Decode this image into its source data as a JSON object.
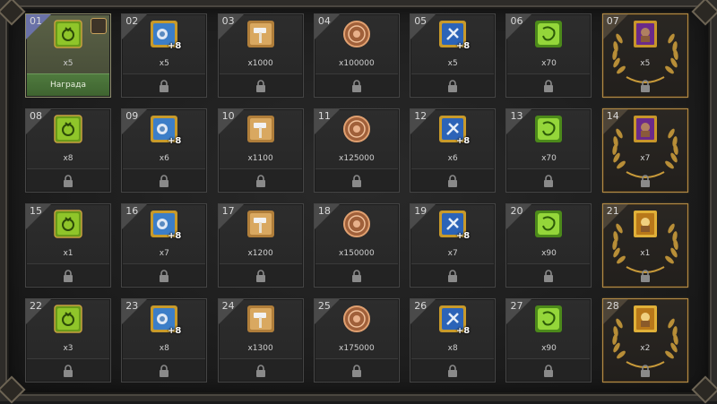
{
  "cells": [
    {
      "day": "01",
      "qty": "x5",
      "icon": "green-scroll-icon",
      "state": "claimable",
      "claim_label": "Награда"
    },
    {
      "day": "02",
      "qty": "x5",
      "icon": "blue-tome-plus8-icon",
      "plus": "+8",
      "state": "locked"
    },
    {
      "day": "03",
      "qty": "x1000",
      "icon": "hammer-tool-icon",
      "state": "locked"
    },
    {
      "day": "04",
      "qty": "x100000",
      "icon": "bronze-coin-icon",
      "state": "locked"
    },
    {
      "day": "05",
      "qty": "x5",
      "icon": "blue-card-plus8-icon",
      "plus": "+8",
      "state": "locked"
    },
    {
      "day": "06",
      "qty": "x70",
      "icon": "green-parchment-icon",
      "state": "locked"
    },
    {
      "day": "07",
      "qty": "x5",
      "icon": "purple-card-icon",
      "state": "locked",
      "gold": true
    },
    {
      "day": "08",
      "qty": "x8",
      "icon": "green-scroll-icon",
      "state": "locked"
    },
    {
      "day": "09",
      "qty": "x6",
      "icon": "blue-tome-plus8-icon",
      "plus": "+8",
      "state": "locked"
    },
    {
      "day": "10",
      "qty": "x1100",
      "icon": "hammer-tool-icon",
      "state": "locked"
    },
    {
      "day": "11",
      "qty": "x125000",
      "icon": "bronze-coin-icon",
      "state": "locked"
    },
    {
      "day": "12",
      "qty": "x6",
      "icon": "blue-card-plus8-icon",
      "plus": "+8",
      "state": "locked"
    },
    {
      "day": "13",
      "qty": "x70",
      "icon": "green-parchment-icon",
      "state": "locked"
    },
    {
      "day": "14",
      "qty": "x7",
      "icon": "purple-card-icon",
      "state": "locked",
      "gold": true
    },
    {
      "day": "15",
      "qty": "x1",
      "icon": "green-scroll-icon",
      "state": "locked"
    },
    {
      "day": "16",
      "qty": "x7",
      "icon": "blue-tome-plus8-icon",
      "plus": "+8",
      "state": "locked"
    },
    {
      "day": "17",
      "qty": "x1200",
      "icon": "hammer-tool-icon",
      "state": "locked"
    },
    {
      "day": "18",
      "qty": "x150000",
      "icon": "bronze-coin-icon",
      "state": "locked"
    },
    {
      "day": "19",
      "qty": "x7",
      "icon": "blue-card-plus8-icon",
      "plus": "+8",
      "state": "locked"
    },
    {
      "day": "20",
      "qty": "x90",
      "icon": "green-parchment-icon",
      "state": "locked"
    },
    {
      "day": "21",
      "qty": "x1",
      "icon": "gold-card-icon",
      "state": "locked",
      "gold": true
    },
    {
      "day": "22",
      "qty": "x3",
      "icon": "green-scroll-icon",
      "state": "locked"
    },
    {
      "day": "23",
      "qty": "x8",
      "icon": "blue-tome-plus8-icon",
      "plus": "+8",
      "state": "locked"
    },
    {
      "day": "24",
      "qty": "x1300",
      "icon": "hammer-tool-icon",
      "state": "locked"
    },
    {
      "day": "25",
      "qty": "x175000",
      "icon": "bronze-coin-icon",
      "state": "locked"
    },
    {
      "day": "26",
      "qty": "x8",
      "icon": "blue-card-plus8-icon",
      "plus": "+8",
      "state": "locked"
    },
    {
      "day": "27",
      "qty": "x90",
      "icon": "green-parchment-icon",
      "state": "locked"
    },
    {
      "day": "28",
      "qty": "x2",
      "icon": "gold-card-icon",
      "state": "locked",
      "gold": true
    }
  ],
  "colors": {
    "claim_green": "#4f7a3e",
    "gold_border": "#b28a45",
    "active_bg": "#5b6247",
    "active_corner": "#6a72a8"
  }
}
